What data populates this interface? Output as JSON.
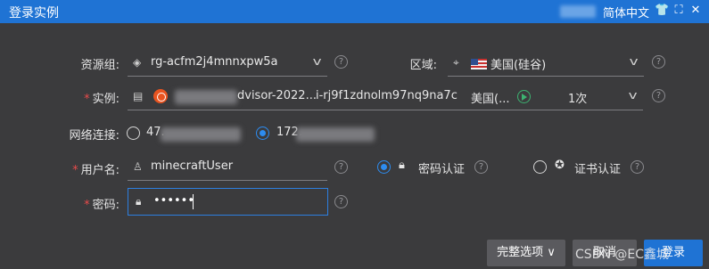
{
  "window": {
    "title": "登录实例",
    "language": "简体中文"
  },
  "form": {
    "resource_group": {
      "label": "资源组:",
      "value": "rg-acfm2j4mnnxpw5a"
    },
    "region": {
      "label": "区域:",
      "value": "美国(硅谷)"
    },
    "instance": {
      "label": "实例:",
      "name_suffix": "dvisor-2022...",
      "id": "i-rj9f1zdnolm97nq9na7c",
      "region": "美国(...",
      "count": "1次"
    },
    "network": {
      "label": "网络连接:",
      "public_prefix": "47.",
      "private_prefix": "172."
    },
    "username": {
      "label": "用户名:",
      "value": "minecraftUser"
    },
    "auth": {
      "password_auth": "密码认证",
      "cert_auth": "证书认证"
    },
    "password": {
      "label": "密码:",
      "value": "••••••"
    }
  },
  "footer": {
    "advanced_label": "完整选项",
    "cancel_label": "取消",
    "login_label": "登录"
  },
  "watermark": "CSDN @EC鑫城"
}
